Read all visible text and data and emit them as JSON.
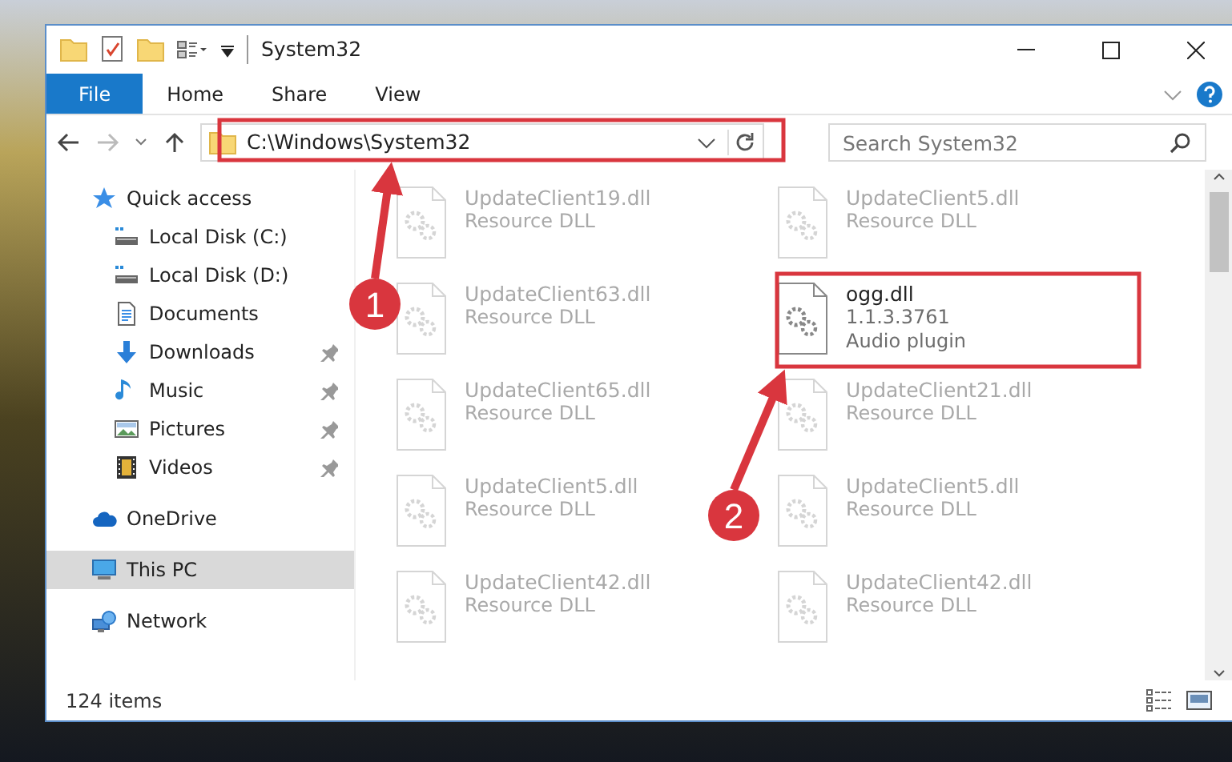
{
  "window": {
    "title": "System32"
  },
  "ribbon_tabs": [
    {
      "label": "File",
      "selected": true
    },
    {
      "label": "Home",
      "selected": false
    },
    {
      "label": "Share",
      "selected": false
    },
    {
      "label": "View",
      "selected": false
    }
  ],
  "address_bar": {
    "path": "C:\\Windows\\System32"
  },
  "search": {
    "placeholder": "Search System32"
  },
  "sidebar": {
    "items": [
      {
        "label": "Quick access",
        "selected": false,
        "children": [
          {
            "label": "Local Disk (C:)",
            "pinned": false,
            "selected": false
          },
          {
            "label": "Local Disk (D:)",
            "pinned": false,
            "selected": false
          },
          {
            "label": "Documents",
            "pinned": false,
            "selected": false
          },
          {
            "label": "Downloads",
            "pinned": true,
            "selected": false
          },
          {
            "label": "Music",
            "pinned": true,
            "selected": false
          },
          {
            "label": "Pictures",
            "pinned": true,
            "selected": false
          },
          {
            "label": "Videos",
            "pinned": true,
            "selected": false
          }
        ]
      },
      {
        "label": "OneDrive",
        "selected": false
      },
      {
        "label": "This PC",
        "selected": true
      },
      {
        "label": "Network",
        "selected": false
      }
    ]
  },
  "files": [
    {
      "name": "UpdateClient19.dll",
      "details": [
        "Resource DLL"
      ],
      "faded": true
    },
    {
      "name": "UpdateClient5.dll",
      "details": [
        "Resource DLL"
      ],
      "faded": true
    },
    {
      "name": "UpdateClient63.dll",
      "details": [
        "Resource DLL"
      ],
      "faded": true
    },
    {
      "name": "ogg.dll",
      "details": [
        "1.1.3.3761",
        "Audio plugin"
      ],
      "faded": false
    },
    {
      "name": "UpdateClient65.dll",
      "details": [
        "Resource DLL"
      ],
      "faded": true
    },
    {
      "name": "UpdateClient21.dll",
      "details": [
        "Resource DLL"
      ],
      "faded": true
    },
    {
      "name": "UpdateClient5.dll",
      "details": [
        "Resource DLL"
      ],
      "faded": true
    },
    {
      "name": "UpdateClient5.dll",
      "details": [
        "Resource DLL"
      ],
      "faded": true
    },
    {
      "name": "UpdateClient42.dll",
      "details": [
        "Resource DLL"
      ],
      "faded": true
    },
    {
      "name": "UpdateClient42.dll",
      "details": [
        "Resource DLL"
      ],
      "faded": true
    }
  ],
  "status_bar": {
    "item_count": "124 items"
  },
  "annotations": [
    {
      "number": "1"
    },
    {
      "number": "2"
    }
  ]
}
